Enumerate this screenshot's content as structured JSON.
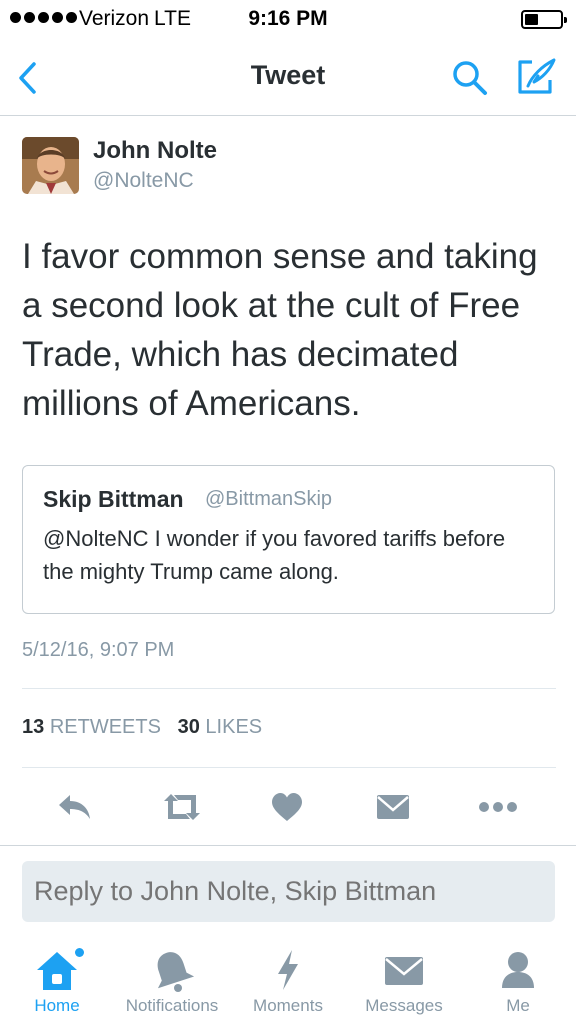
{
  "status_bar": {
    "carrier": "Verizon",
    "network": "LTE",
    "time": "9:16 PM",
    "signal_bars": 5,
    "battery_level": 0.3
  },
  "nav": {
    "title": "Tweet",
    "icons": [
      "back-icon",
      "search-icon",
      "compose-icon"
    ],
    "accent_color": "#1da1f2"
  },
  "tweet": {
    "author_name": "John Nolte",
    "author_handle": "@NolteNC",
    "text": "I favor common sense and taking a second look at the cult of Free Trade, which has decimated millions of Americans.",
    "timestamp": "5/12/16, 9:07 PM",
    "retweets_count": "13",
    "retweets_label": "RETWEETS",
    "likes_count": "30",
    "likes_label": "LIKES"
  },
  "quoted_tweet": {
    "author_name": "Skip Bittman",
    "author_handle": "@BittmanSkip",
    "text": "@NolteNC I wonder if you favored tariffs before the mighty Trump came along."
  },
  "actions": [
    "reply-icon",
    "retweet-icon",
    "like-icon",
    "direct-message-icon",
    "more-icon"
  ],
  "reply_box": {
    "placeholder": "Reply to John Nolte, Skip Bittman"
  },
  "tab_bar": {
    "items": [
      {
        "label": "Home",
        "icon": "home-icon",
        "active": true
      },
      {
        "label": "Notifications",
        "icon": "bell-icon",
        "active": false
      },
      {
        "label": "Moments",
        "icon": "lightning-icon",
        "active": false
      },
      {
        "label": "Messages",
        "icon": "envelope-icon",
        "active": false
      },
      {
        "label": "Me",
        "icon": "person-icon",
        "active": false
      }
    ]
  },
  "colors": {
    "accent": "#1da1f2",
    "icon_gray": "#8899a6",
    "text": "#292f33"
  }
}
